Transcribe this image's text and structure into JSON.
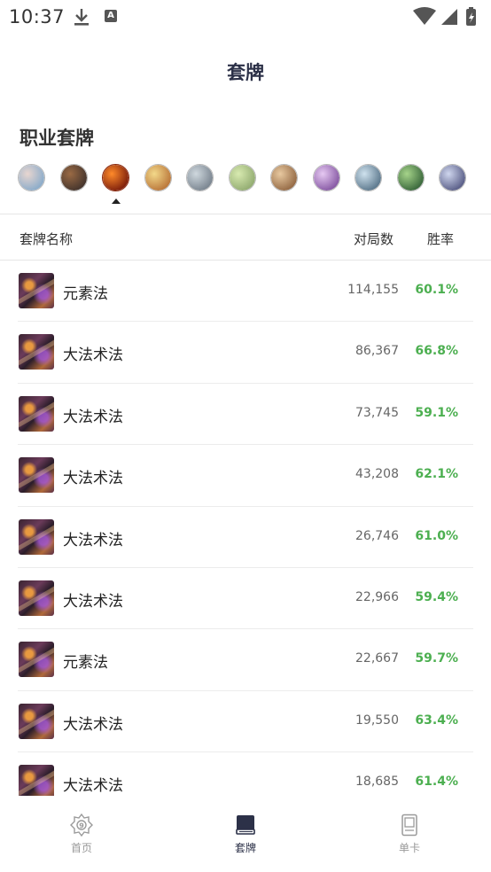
{
  "status": {
    "time": "10:37"
  },
  "header": {
    "title": "套牌"
  },
  "section": {
    "title": "职业套牌"
  },
  "classes": [
    {
      "name": "class-1",
      "colors": [
        "#e8d6d0",
        "#7fa6c9"
      ]
    },
    {
      "name": "class-2",
      "colors": [
        "#9a6a44",
        "#3a2e2a"
      ]
    },
    {
      "name": "class-3",
      "colors": [
        "#ff8a2a",
        "#6e1208"
      ],
      "active": true
    },
    {
      "name": "class-4",
      "colors": [
        "#f3d98a",
        "#b36a30"
      ]
    },
    {
      "name": "class-5",
      "colors": [
        "#cfd8de",
        "#6f7a86"
      ]
    },
    {
      "name": "class-6",
      "colors": [
        "#d8eab0",
        "#8aa46a"
      ]
    },
    {
      "name": "class-7",
      "colors": [
        "#e8c9a0",
        "#8a5e3a"
      ]
    },
    {
      "name": "class-8",
      "colors": [
        "#e6c9f2",
        "#7a4a9a"
      ]
    },
    {
      "name": "class-9",
      "colors": [
        "#cfe2ee",
        "#4d6a80"
      ]
    },
    {
      "name": "class-10",
      "colors": [
        "#a6d48a",
        "#2c5a32"
      ]
    },
    {
      "name": "class-11",
      "colors": [
        "#cfd6ee",
        "#4a4e7a"
      ]
    }
  ],
  "table": {
    "col_name": "套牌名称",
    "col_games": "对局数",
    "col_winrate": "胜率",
    "rows": [
      {
        "name": "元素法",
        "games": "114,155",
        "winrate": "60.1%"
      },
      {
        "name": "大法术法",
        "games": "86,367",
        "winrate": "66.8%"
      },
      {
        "name": "大法术法",
        "games": "73,745",
        "winrate": "59.1%"
      },
      {
        "name": "大法术法",
        "games": "43,208",
        "winrate": "62.1%"
      },
      {
        "name": "大法术法",
        "games": "26,746",
        "winrate": "61.0%"
      },
      {
        "name": "大法术法",
        "games": "22,966",
        "winrate": "59.4%"
      },
      {
        "name": "元素法",
        "games": "22,667",
        "winrate": "59.7%"
      },
      {
        "name": "大法术法",
        "games": "19,550",
        "winrate": "63.4%"
      },
      {
        "name": "大法术法",
        "games": "18,685",
        "winrate": "61.4%"
      }
    ]
  },
  "nav": {
    "home": "首页",
    "decks": "套牌",
    "cards": "单卡"
  },
  "colors": {
    "accent": "#2c3148",
    "winrate": "#4caf50"
  }
}
